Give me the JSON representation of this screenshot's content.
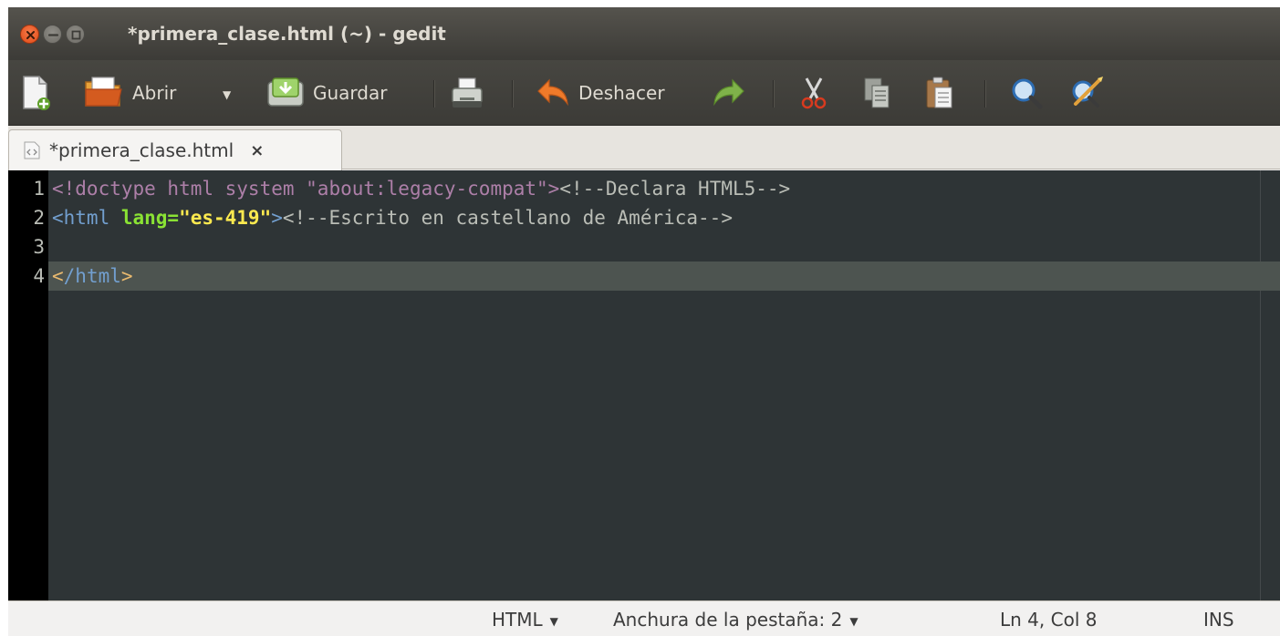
{
  "window": {
    "title": "*primera_clase.html (~) - gedit"
  },
  "toolbar": {
    "open_label": "Abrir",
    "save_label": "Guardar",
    "undo_label": "Deshacer"
  },
  "tab": {
    "label": "*primera_clase.html",
    "close": "×"
  },
  "editor": {
    "lines": [
      {
        "number": "1",
        "parts": [
          {
            "cls": "c-doctype",
            "text": "<!doctype html system "
          },
          {
            "cls": "c-string",
            "text": "\"about:legacy-compat\""
          },
          {
            "cls": "c-doctype",
            "text": ">"
          },
          {
            "cls": "c-comment",
            "text": "<!--Declara HTML5-->"
          }
        ]
      },
      {
        "number": "2",
        "parts": [
          {
            "cls": "c-tag",
            "text": "<html "
          },
          {
            "cls": "c-attr",
            "text": "lang="
          },
          {
            "cls": "c-val",
            "text": "\"es-419\""
          },
          {
            "cls": "c-tag",
            "text": ">"
          },
          {
            "cls": "c-comment",
            "text": "<!--Escrito en castellano de América-->"
          }
        ]
      },
      {
        "number": "3",
        "parts": []
      },
      {
        "number": "4",
        "current": true,
        "parts": [
          {
            "cls": "c-endtag",
            "text": "<"
          },
          {
            "cls": "c-tag",
            "text": "/html"
          },
          {
            "cls": "c-endtag",
            "text": ">"
          }
        ]
      }
    ]
  },
  "statusbar": {
    "language": "HTML",
    "tab_width": "Anchura de la pestaña: 2",
    "position": "Ln 4, Col 8",
    "mode": "INS"
  },
  "colors": {
    "editor_bg": "#2e3436",
    "current_line": "#4d5450",
    "titlebar": "#3c3b37"
  }
}
